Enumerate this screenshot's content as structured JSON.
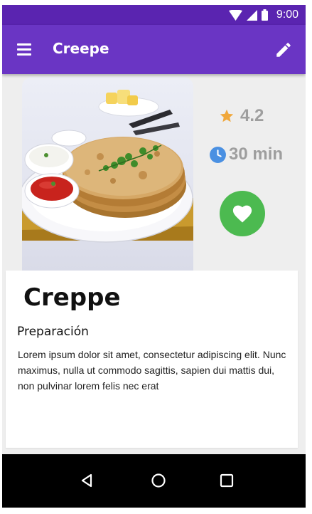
{
  "status_bar": {
    "time": "9:00",
    "icons": [
      "wifi-icon",
      "cell-signal-icon",
      "battery-icon"
    ]
  },
  "app_bar": {
    "title": "Creepe",
    "menu_icon": "menu-icon",
    "action_icon": "edit-pencil-icon"
  },
  "recipe": {
    "rating": "4.2",
    "rating_icon": "star-icon",
    "time": "30 min",
    "time_icon": "clock-icon",
    "favorite_icon": "heart-icon",
    "image": "food-photo",
    "title": "Creppe",
    "section_heading": "Preparación",
    "description": "Lorem ipsum dolor sit amet, consectetur adipiscing elit. Nunc maximus, nulla ut commodo sagittis, sapien dui mattis dui, non pulvinar lorem felis nec erat"
  },
  "nav_bar": {
    "icons": [
      "back-icon",
      "home-icon",
      "recents-icon"
    ]
  },
  "colors": {
    "status_bar": "#5a24b0",
    "app_bar": "#6a35c4",
    "star": "#f0a73a",
    "clock": "#4a90e2",
    "favorite": "#4cba50",
    "background": "#eeeeee",
    "muted_text": "#9e9e9e"
  }
}
